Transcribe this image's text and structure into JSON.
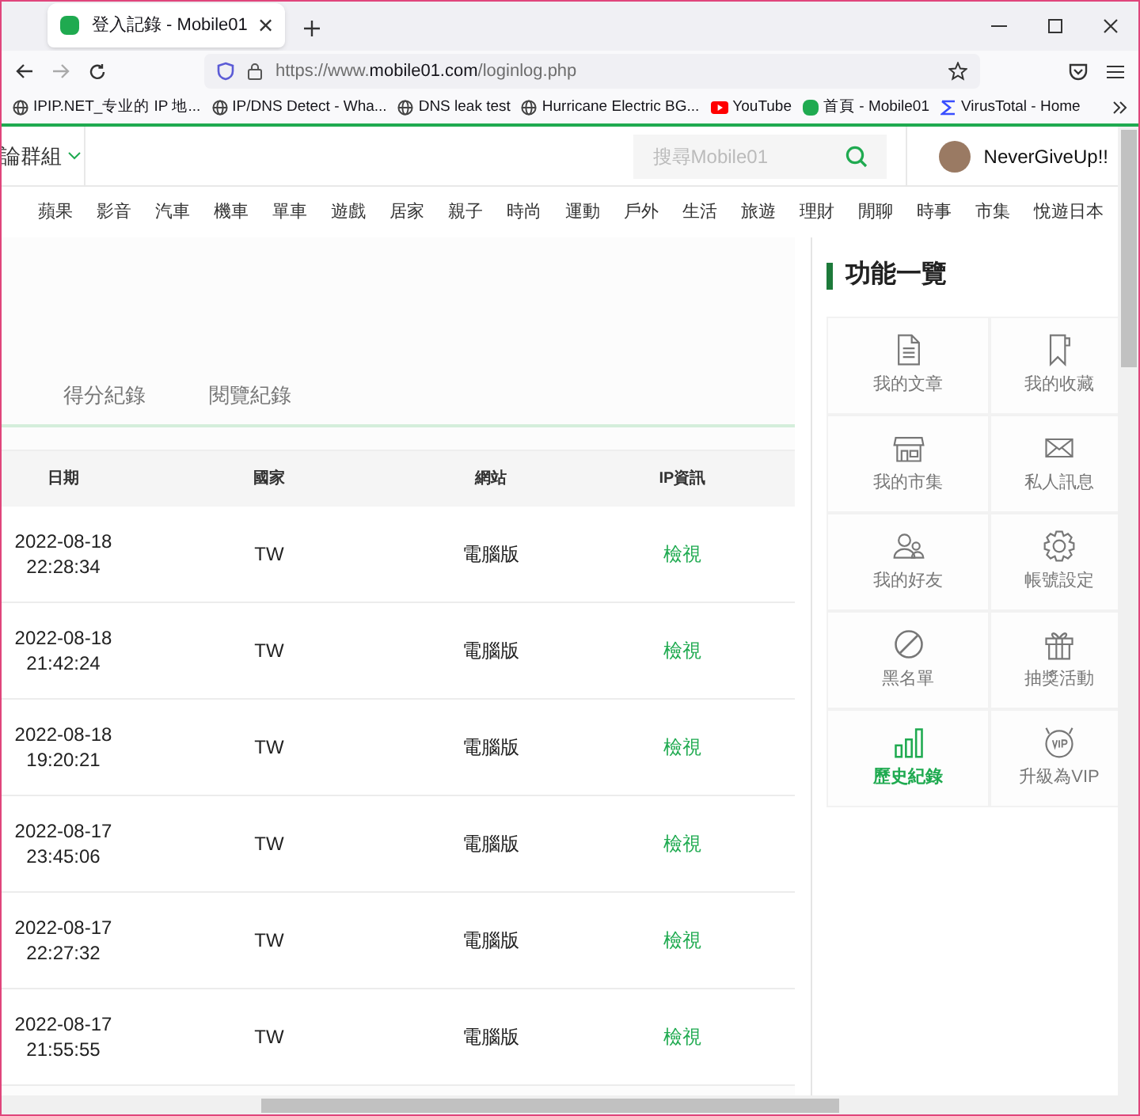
{
  "browser": {
    "tab_title": "登入記錄 - Mobile01",
    "url_prefix": "https://www.",
    "url_domain": "mobile01.com",
    "url_path": "/loginlog.php",
    "bookmarks": [
      {
        "kind": "globe",
        "label": "IPIP.NET_专业的 IP 地..."
      },
      {
        "kind": "globe",
        "label": "IP/DNS Detect - Wha..."
      },
      {
        "kind": "globe",
        "label": "DNS leak test"
      },
      {
        "kind": "globe",
        "label": "Hurricane Electric BG..."
      },
      {
        "kind": "youtube",
        "label": "YouTube"
      },
      {
        "kind": "m01",
        "label": "首頁 - Mobile01"
      },
      {
        "kind": "vt",
        "label": "VirusTotal - Home"
      }
    ]
  },
  "header": {
    "group_label": "論群組",
    "search_placeholder": "搜尋Mobile01",
    "user_name": "NeverGiveUp!!"
  },
  "nav": [
    "蘋果",
    "影音",
    "汽車",
    "機車",
    "單車",
    "遊戲",
    "居家",
    "親子",
    "時尚",
    "運動",
    "戶外",
    "生活",
    "旅遊",
    "理財",
    "閒聊",
    "時事",
    "市集",
    "悅遊日本"
  ],
  "tabs": [
    {
      "label": "得分紀錄",
      "selected": false
    },
    {
      "label": "閱覽紀錄",
      "selected": false
    }
  ],
  "table": {
    "columns": [
      "日期",
      "國家",
      "網站",
      "IP資訊"
    ],
    "rows": [
      {
        "date": "2022-08-18",
        "time": "22:28:34",
        "country": "TW",
        "site": "電腦版",
        "ip": "檢視"
      },
      {
        "date": "2022-08-18",
        "time": "21:42:24",
        "country": "TW",
        "site": "電腦版",
        "ip": "檢視"
      },
      {
        "date": "2022-08-18",
        "time": "19:20:21",
        "country": "TW",
        "site": "電腦版",
        "ip": "檢視"
      },
      {
        "date": "2022-08-17",
        "time": "23:45:06",
        "country": "TW",
        "site": "電腦版",
        "ip": "檢視"
      },
      {
        "date": "2022-08-17",
        "time": "22:27:32",
        "country": "TW",
        "site": "電腦版",
        "ip": "檢視"
      },
      {
        "date": "2022-08-17",
        "time": "21:55:55",
        "country": "TW",
        "site": "電腦版",
        "ip": "檢視"
      }
    ]
  },
  "sidebar": {
    "title": "功能一覽",
    "items": [
      {
        "kind": "document",
        "label": "我的文章",
        "selected": false
      },
      {
        "kind": "bookmark",
        "label": "我的收藏",
        "selected": false
      },
      {
        "kind": "store",
        "label": "我的市集",
        "selected": false
      },
      {
        "kind": "mail",
        "label": "私人訊息",
        "selected": false
      },
      {
        "kind": "friends",
        "label": "我的好友",
        "selected": false
      },
      {
        "kind": "gear",
        "label": "帳號設定",
        "selected": false
      },
      {
        "kind": "ban",
        "label": "黑名單",
        "selected": false
      },
      {
        "kind": "gift",
        "label": "抽獎活動",
        "selected": false
      },
      {
        "kind": "bars",
        "label": "歷史紀錄",
        "selected": true
      },
      {
        "kind": "vip",
        "label": "升級為VIP",
        "selected": false
      }
    ]
  }
}
